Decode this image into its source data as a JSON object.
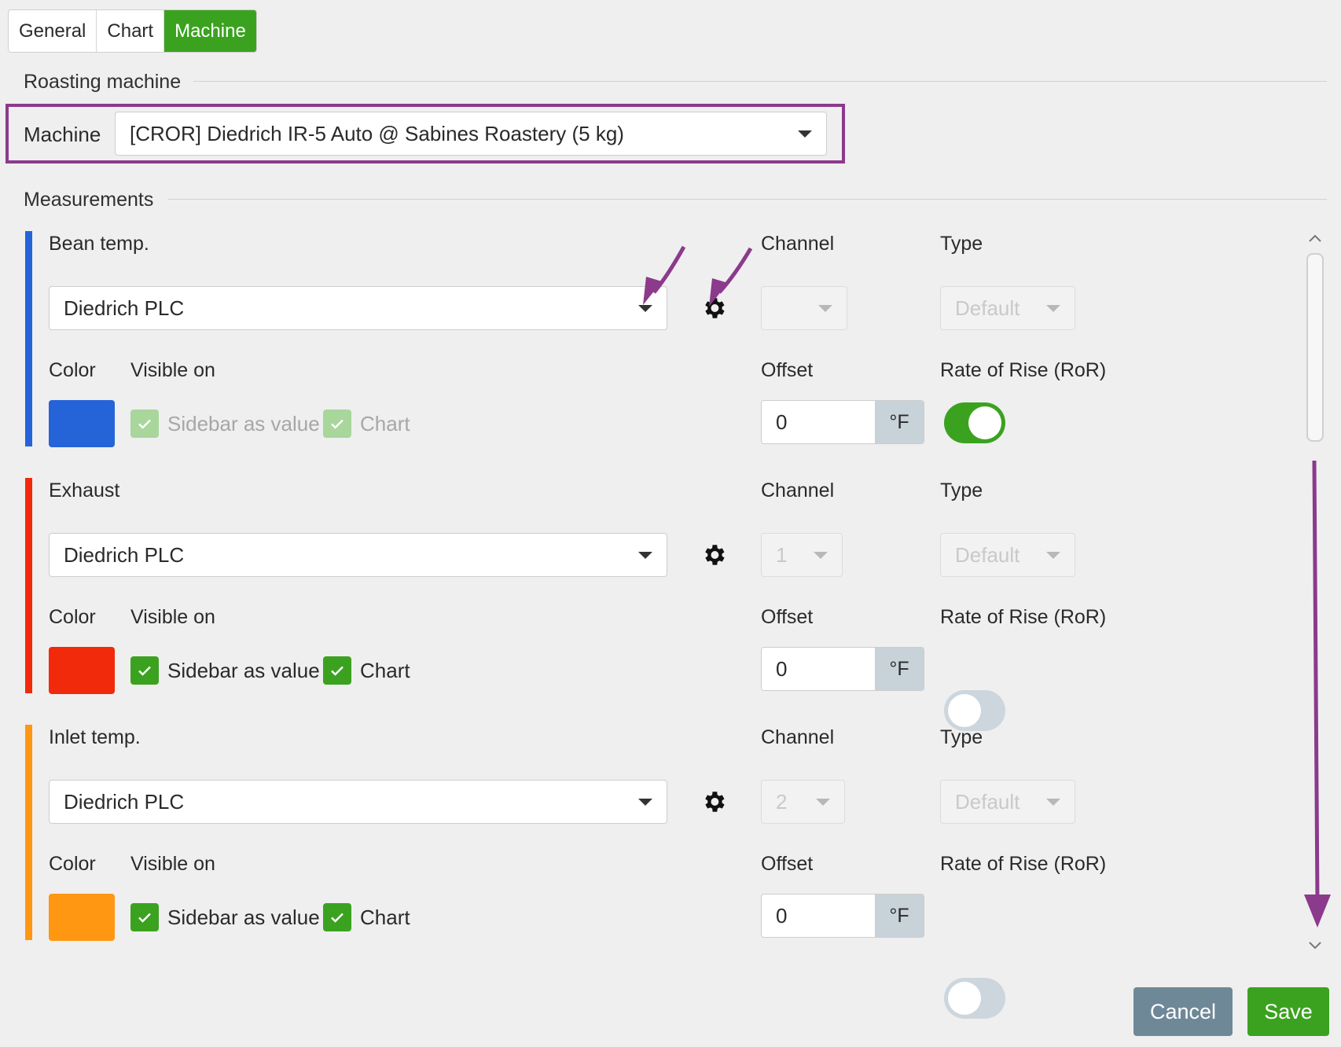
{
  "tabs": [
    {
      "label": "General"
    },
    {
      "label": "Chart"
    },
    {
      "label": "Machine"
    }
  ],
  "roasting_section": {
    "title": "Roasting machine"
  },
  "machine": {
    "label": "Machine",
    "selected": "[CROR] Diedrich IR-5 Auto @ Sabines Roastery (5 kg)"
  },
  "measurements_section": {
    "title": "Measurements"
  },
  "labels": {
    "channel": "Channel",
    "type": "Type",
    "color": "Color",
    "visible_on": "Visible on",
    "offset": "Offset",
    "ror": "Rate of Rise (RoR)",
    "sidebar_as_value": "Sidebar as value",
    "chart": "Chart"
  },
  "measurements": [
    {
      "name": "Bean temp.",
      "source": "Diedrich PLC",
      "channel": "",
      "type": "Default",
      "color": "#2563d9",
      "sidebar_checked": true,
      "chart_checked": true,
      "checks_disabled": true,
      "offset": "0",
      "unit": "°F",
      "ror": true
    },
    {
      "name": "Exhaust",
      "source": "Diedrich PLC",
      "channel": "1",
      "type": "Default",
      "color": "#f02a0a",
      "sidebar_checked": true,
      "chart_checked": true,
      "checks_disabled": false,
      "offset": "0",
      "unit": "°F",
      "ror": false
    },
    {
      "name": "Inlet temp.",
      "source": "Diedrich PLC",
      "channel": "2",
      "type": "Default",
      "color": "#ff9712",
      "sidebar_checked": true,
      "chart_checked": true,
      "checks_disabled": false,
      "offset": "0",
      "unit": "°F",
      "ror": false
    }
  ],
  "icons": {
    "settings": "gear-icon",
    "dropdown": "caret-down-icon",
    "check": "check-icon",
    "scroll_up": "chevron-up-icon",
    "scroll_down": "chevron-down-icon"
  },
  "annotation_color": "#8b3a8c",
  "buttons": {
    "cancel": "Cancel",
    "save": "Save"
  }
}
